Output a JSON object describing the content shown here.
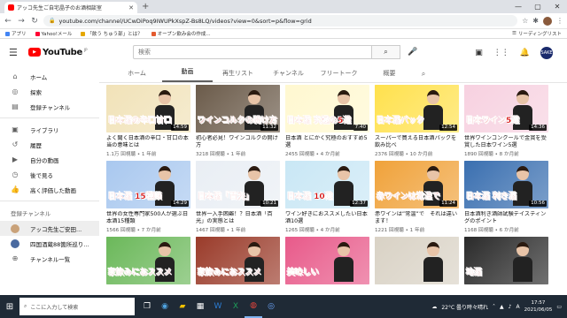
{
  "browser": {
    "tab_title": "アッコ先生ご自宅晶子のお酒相談室",
    "url": "youtube.com/channel/UCwDiPoq9IWUPkXspZ-Bs8LQ/videos?view=0&sort=p&flow=grid",
    "bookmarks": [
      "アプリ",
      "Yahoo!メール",
      "「飲う ちゅう部」とは？",
      "オープン飲み会の作成..."
    ],
    "bookmarks_right": "リーディングリスト"
  },
  "header": {
    "logo_text": "YouTube",
    "logo_region": "JP",
    "search_placeholder": "検索",
    "avatar_text": "SAKE"
  },
  "sidebar": {
    "items": [
      {
        "icon": "home-icon",
        "glyph": "⌂",
        "label": "ホーム"
      },
      {
        "icon": "explore-icon",
        "glyph": "◎",
        "label": "探索"
      },
      {
        "icon": "subscriptions-icon",
        "glyph": "▤",
        "label": "登録チャンネル"
      }
    ],
    "library_items": [
      {
        "icon": "library-icon",
        "glyph": "▣",
        "label": "ライブラリ"
      },
      {
        "icon": "history-icon",
        "glyph": "↺",
        "label": "履歴"
      },
      {
        "icon": "my-videos-icon",
        "glyph": "▶",
        "label": "自分の動画"
      },
      {
        "icon": "watch-later-icon",
        "glyph": "◷",
        "label": "後で見る"
      },
      {
        "icon": "liked-icon",
        "glyph": "👍",
        "label": "高く評価した動画"
      }
    ],
    "subs_heading": "登録チャンネル",
    "channels": [
      {
        "label": "アッコ先生ご安田..."
      },
      {
        "label": "四国酒蔵88箇所巡り..."
      }
    ],
    "channel_list_label": "チャンネル一覧"
  },
  "channel_tabs": [
    "ホーム",
    "動画",
    "再生リスト",
    "チャンネル",
    "フリートーク",
    "概要"
  ],
  "active_tab": "動画",
  "colors": {
    "accent": "#ff0000",
    "taskbar": "#1f2a36"
  },
  "videos": [
    {
      "thumb_text": "日本酒の辛口甘口",
      "duration": "14:59",
      "title": "よく聞く日本酒の辛口・甘口の本当の意味とは",
      "views": "1.1万 回視聴",
      "age": "1 年前",
      "bg": "#f1e2b8"
    },
    {
      "thumb_text": "ワインコルクの開け方",
      "duration": "11:32",
      "title": "初心者必見！ワインコルクの開け方",
      "views": "3218 回視聴",
      "age": "1 年前",
      "bg": "#6b5b4a"
    },
    {
      "thumb_text": "日本酒 究極の5選",
      "duration": "7:40",
      "title": "日本酒 とにかく究極のおすすめ5選",
      "views": "2455 回視聴",
      "age": "4 か月前",
      "bg": "#fff8d0"
    },
    {
      "thumb_text": "日本酒パック",
      "duration": "12:54",
      "title": "スーパーで買える日本酒パックを飲み比べ",
      "views": "2376 回視聴",
      "age": "10 か月前",
      "bg": "#ffe14d"
    },
    {
      "thumb_text": "日本ワイン5選",
      "duration": "14:36",
      "title": "世界ワインコンクールで金賞を受賞した日本ワイン5選",
      "views": "1890 回視聴",
      "age": "8 か月前",
      "bg": "#f7d1e0"
    },
    {
      "thumb_text": "日本酒 15種類",
      "duration": "14:29",
      "title": "世界の女性専門家500人が選ぶ日本酒15種類",
      "views": "1566 回視聴",
      "age": "7 か月前",
      "bg": "#a9c8ef"
    },
    {
      "thumb_text": "日本酒「百光」",
      "duration": "10:21",
      "title": "世界一入手困難！？日本酒「百光」の実態とは",
      "views": "1467 回視聴",
      "age": "1 年前",
      "bg": "#e9eef4"
    },
    {
      "thumb_text": "日本酒 10選",
      "duration": "12:37",
      "title": "ワイン好きにおススメしたい日本酒10選",
      "views": "1265 回視聴",
      "age": "4 か月前",
      "bg": "#c9e7f5"
    },
    {
      "thumb_text": "赤ワインは常温で",
      "duration": "11:24",
      "title": "赤ワインは”常温”で　それは違います！",
      "views": "1221 回視聴",
      "age": "1 年前",
      "bg": "#f0a23a"
    },
    {
      "thumb_text": "日本酒 利き酒",
      "duration": "10:56",
      "title": "日本酒利き酒師試験テイスティングのポイント",
      "views": "1168 回視聴",
      "age": "6 か月前",
      "bg": "#3a6fb0"
    },
    {
      "thumb_text": "家飲みにおススメ",
      "duration": "",
      "title": "",
      "views": "",
      "age": "",
      "bg": "#6bb85a"
    },
    {
      "thumb_text": "家飲みにおススメ",
      "duration": "",
      "title": "",
      "views": "",
      "age": "",
      "bg": "#9a3b2a"
    },
    {
      "thumb_text": "美味しい",
      "duration": "",
      "title": "",
      "views": "",
      "age": "",
      "bg": "#e85a8a"
    },
    {
      "thumb_text": "",
      "duration": "",
      "title": "",
      "views": "",
      "age": "",
      "bg": "#d9d2c5"
    },
    {
      "thumb_text": "地酒",
      "duration": "",
      "title": "",
      "views": "",
      "age": "",
      "bg": "#2a2a2a"
    }
  ],
  "taskbar": {
    "search_placeholder": "ここに入力して検索",
    "weather": "22°C 曇り時々晴れ",
    "time": "17:57",
    "date": "2021/06/05"
  }
}
